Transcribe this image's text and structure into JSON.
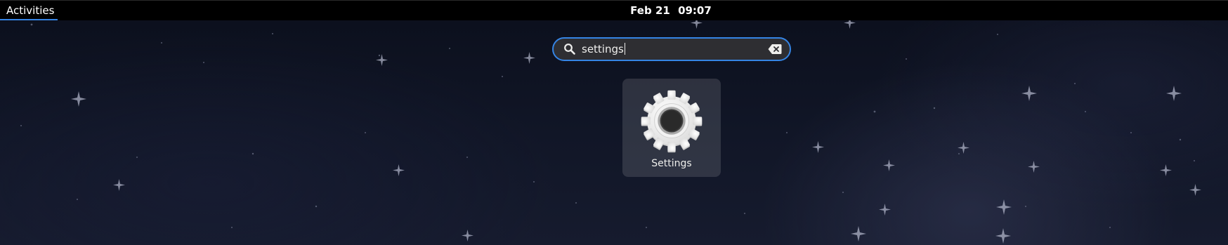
{
  "topbar": {
    "activities_label": "Activities",
    "date": "Feb 21",
    "time": "09:07"
  },
  "search": {
    "value": "settings",
    "icon": "search-icon",
    "clear_icon": "edit-clear-icon"
  },
  "results": [
    {
      "label": "Settings",
      "icon": "gear-icon"
    }
  ],
  "colors": {
    "accent": "#3584e4",
    "topbar": "#000000",
    "search_bg": "#2e2e32"
  }
}
